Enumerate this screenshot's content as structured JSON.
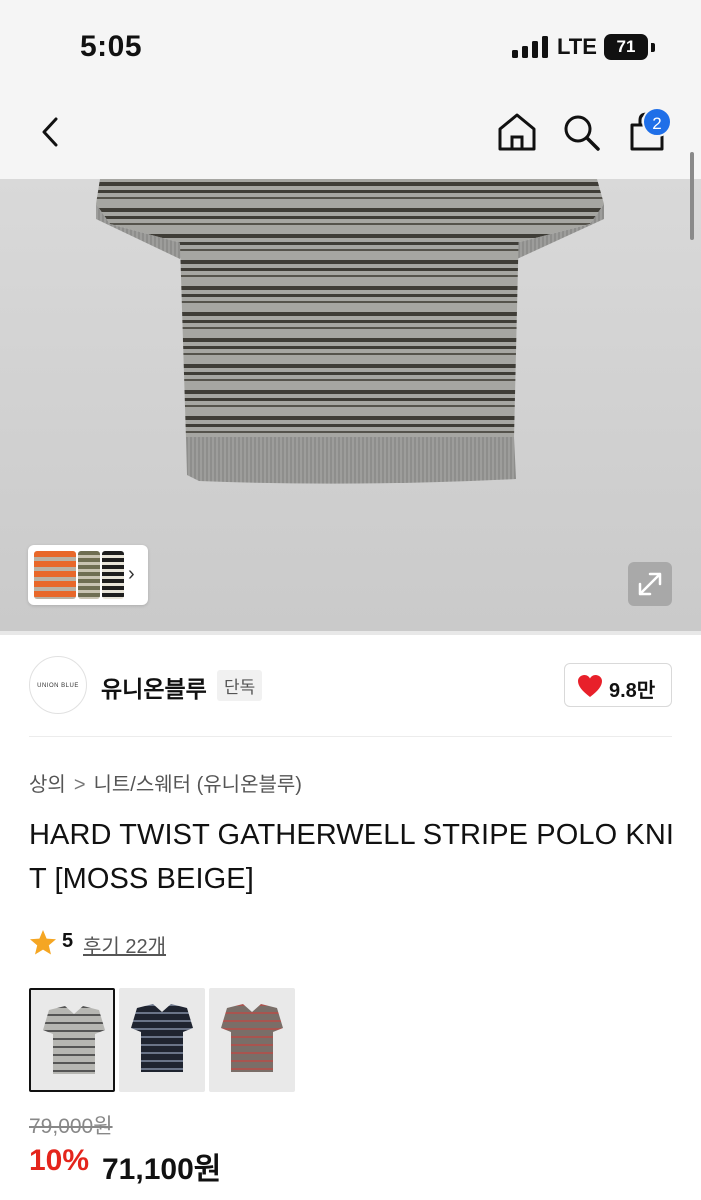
{
  "status_bar": {
    "time": "5:05",
    "network": "LTE",
    "battery": "71"
  },
  "nav": {
    "cart_count": "2"
  },
  "gallery": {
    "thumbnail_nav": "›"
  },
  "brand": {
    "name": "유니온블루",
    "tag": "단독",
    "logo_text": "UNION BLUE",
    "likes": "9.8만"
  },
  "breadcrumb": {
    "first": "상의",
    "separator": ">",
    "second": "니트/스웨터 (유니온블루)"
  },
  "product": {
    "title": "HARD TWIST GATHERWELL STRIPE POLO KNIT [MOSS BEIGE]",
    "rating": "5",
    "reviews": "후기 22개",
    "original_price": "79,000원",
    "discount": "10%",
    "sale_price": "71,100원"
  },
  "colors": {
    "accent_blue": "#1f6fe8",
    "sale_red": "#e4251c",
    "heart_red": "#e8202a",
    "star_orange": "#f5a623"
  },
  "color_options": [
    "moss-beige",
    "navy",
    "brown"
  ]
}
